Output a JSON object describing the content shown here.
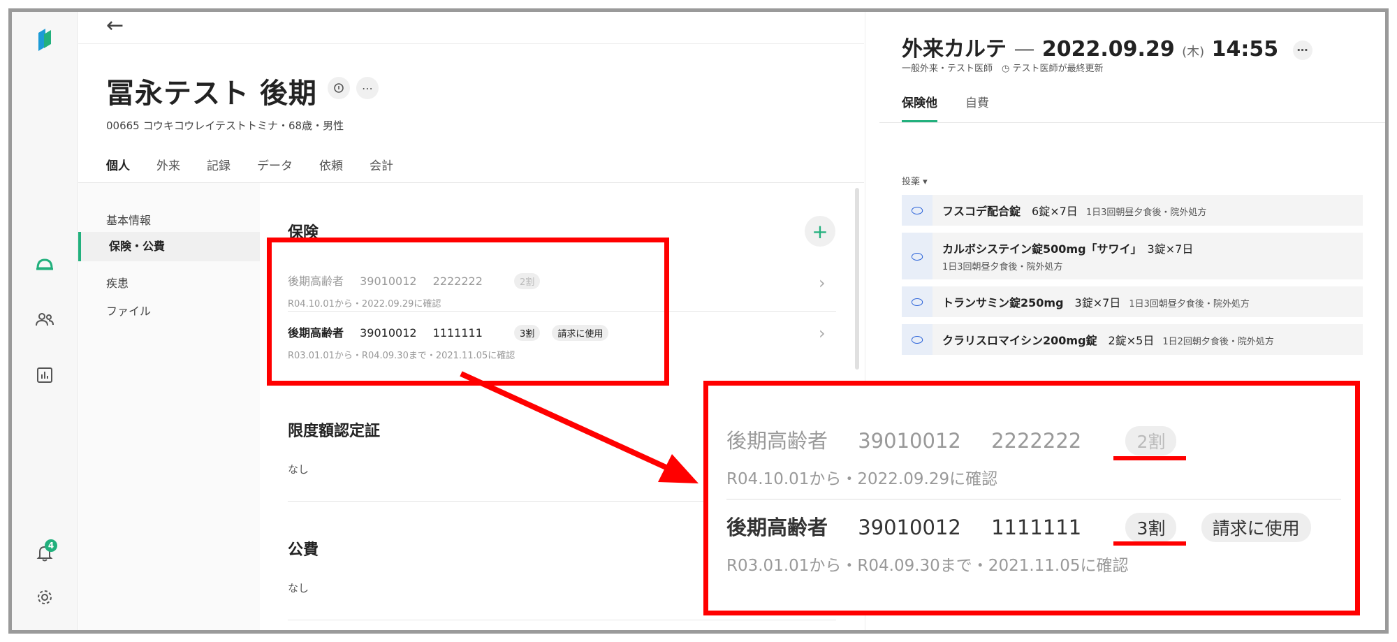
{
  "patient": {
    "name": "冨永テスト 後期",
    "subtitle": "00665 コウキコウレイテストトミナ・68歳・男性",
    "more_icon": "ellipsis",
    "tabs": [
      "個人",
      "外来",
      "記録",
      "データ",
      "依頼",
      "会計"
    ],
    "side_items": [
      "基本情報",
      "保険・公費",
      "疾患",
      "ファイル"
    ],
    "sections": {
      "insurance_title": "保険",
      "limit_title": "限度額認定証",
      "limit_value": "なし",
      "public_title": "公費",
      "public_value": "なし"
    },
    "insurances": [
      {
        "type": "後期高齢者",
        "insurer": "39010012",
        "number": "2222222",
        "rate": "2割",
        "status": "",
        "period": "R04.10.01から・2022.09.29に確認"
      },
      {
        "type": "後期高齢者",
        "insurer": "39010012",
        "number": "1111111",
        "rate": "3割",
        "status": "請求に使用",
        "period": "R03.01.01から・R04.09.30まで・2021.11.05に確認"
      }
    ]
  },
  "chart": {
    "title_prefix": "外来カルテ",
    "title_sep": "—",
    "date": "2022.09.29",
    "dow": "(木)",
    "time": "14:55",
    "meta": "一般外来・テスト医師　◷ テスト医師が最終更新",
    "tabs": [
      "保険他",
      "自費"
    ],
    "section": "投薬 ▾",
    "prescriptions": [
      {
        "name": "フスコデ配合錠",
        "dose": "6錠×7日",
        "note": "1日3回朝昼夕食後・院外処方",
        "wrap": false
      },
      {
        "name": "カルボシステイン錠500mg「サワイ」",
        "dose": "3錠×7日",
        "note": "1日3回朝昼夕食後・院外処方",
        "wrap": true
      },
      {
        "name": "トランサミン錠250mg",
        "dose": "3錠×7日",
        "note": "1日3回朝昼夕食後・院外処方",
        "wrap": false
      },
      {
        "name": "クラリスロマイシン200mg錠",
        "dose": "2錠×5日",
        "note": "1日2回朝夕食後・院外処方",
        "wrap": false
      }
    ]
  },
  "notifications": {
    "count": "4"
  },
  "colors": {
    "accent": "#22b07d",
    "annotation": "#ff0000",
    "rx_icon": "#2b63d9"
  }
}
